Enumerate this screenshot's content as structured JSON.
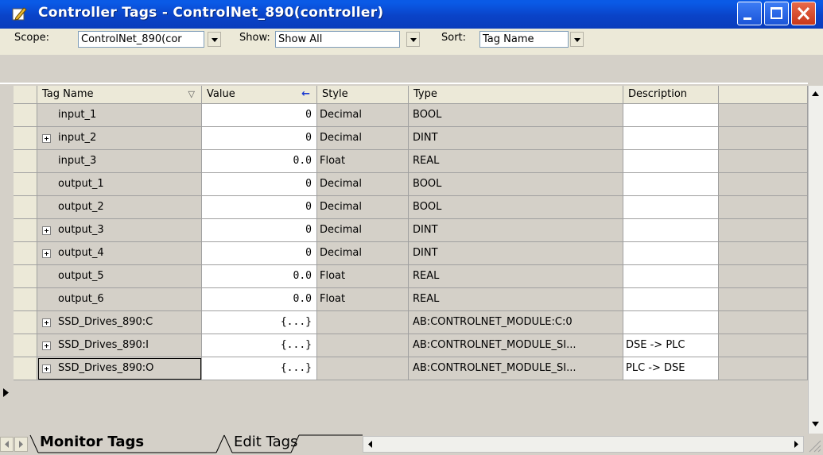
{
  "window": {
    "title": "Controller Tags - ControlNet_890(controller)"
  },
  "toolbar": {
    "scope_label": "Scope:",
    "scope_value": "ControlNet_890(cor",
    "show_label": "Show:",
    "show_value": "Show All",
    "sort_label": "Sort:",
    "sort_value": "Tag Name"
  },
  "columns": {
    "tag_name": "Tag Name",
    "value": "Value",
    "style": "Style",
    "type": "Type",
    "description": "Description"
  },
  "rows": [
    {
      "name": "input_1",
      "value": "0",
      "style": "Decimal",
      "type": "BOOL",
      "description": "",
      "expandable": false
    },
    {
      "name": "input_2",
      "value": "0",
      "style": "Decimal",
      "type": "DINT",
      "description": "",
      "expandable": true
    },
    {
      "name": "input_3",
      "value": "0.0",
      "style": "Float",
      "type": "REAL",
      "description": "",
      "expandable": false
    },
    {
      "name": "output_1",
      "value": "0",
      "style": "Decimal",
      "type": "BOOL",
      "description": "",
      "expandable": false
    },
    {
      "name": "output_2",
      "value": "0",
      "style": "Decimal",
      "type": "BOOL",
      "description": "",
      "expandable": false
    },
    {
      "name": "output_3",
      "value": "0",
      "style": "Decimal",
      "type": "DINT",
      "description": "",
      "expandable": true
    },
    {
      "name": "output_4",
      "value": "0",
      "style": "Decimal",
      "type": "DINT",
      "description": "",
      "expandable": true
    },
    {
      "name": "output_5",
      "value": "0.0",
      "style": "Float",
      "type": "REAL",
      "description": "",
      "expandable": false
    },
    {
      "name": "output_6",
      "value": "0.0",
      "style": "Float",
      "type": "REAL",
      "description": "",
      "expandable": false
    },
    {
      "name": "SSD_Drives_890:C",
      "value": "{...}",
      "style": "",
      "type": "AB:CONTROLNET_MODULE:C:0",
      "description": "",
      "expandable": true
    },
    {
      "name": "SSD_Drives_890:I",
      "value": "{...}",
      "style": "",
      "type": "AB:CONTROLNET_MODULE_SI...",
      "description": "DSE -> PLC",
      "expandable": true
    },
    {
      "name": "SSD_Drives_890:O",
      "value": "{...}",
      "style": "",
      "type": "AB:CONTROLNET_MODULE_SI...",
      "description": "PLC -> DSE",
      "expandable": true
    }
  ],
  "tabs": {
    "monitor": "Monitor Tags",
    "edit": "Edit Tags"
  },
  "colors": {
    "titlebar": "#0a43c8",
    "close_button": "#c8371a",
    "grid_gray": "#d4d0c8",
    "editable_white": "#ffffff"
  }
}
